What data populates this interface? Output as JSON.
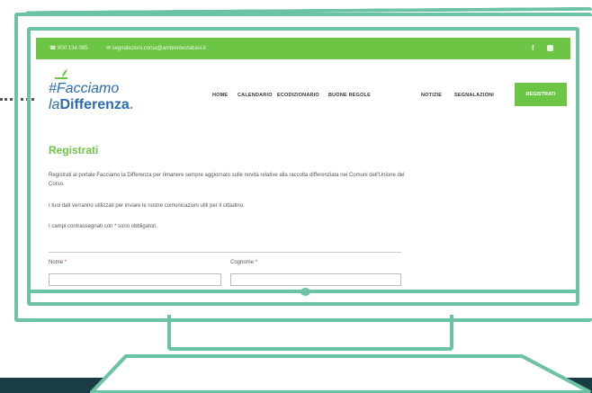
{
  "topbar": {
    "phone": "☎ 800 134 085",
    "email": "✉ segnalazioni.corsa@ambientestabasi.it",
    "facebook": "f"
  },
  "logo": {
    "line1": "#Facciamo",
    "line2_italic": "la",
    "line2_bold": "Differenza",
    "dot": "."
  },
  "nav": {
    "items": [
      "HOME",
      "CALENDARIO",
      "ECODIZIONARIO",
      "BUONE REGOLE",
      "NOTIZIE",
      "SEGNALAZIONI"
    ],
    "cta": "REGISTRATI"
  },
  "page": {
    "title": "Registrati",
    "intro": "Registrati al portale Facciamo la Differenza per rimanere sempre aggiornato sulle novità relative alla raccolta differenziata nei Comuni dell'Unione del Corso.",
    "privacy": "I tuoi dati verranno utilizzati per inviare le nostre comunicazioni utili per il cittadino.",
    "required_prefix": "I campi contrassegnati con ",
    "required_star": "*",
    "required_suffix": " sono obbligatori.",
    "fields": {
      "nome_label": "Nome",
      "cognome_label": "Cognome",
      "star": "*"
    }
  },
  "colors": {
    "accent": "#6dc546",
    "outline": "#6cc3a4",
    "brand_blue": "#2a6db0",
    "floor": "#1a3c44"
  }
}
